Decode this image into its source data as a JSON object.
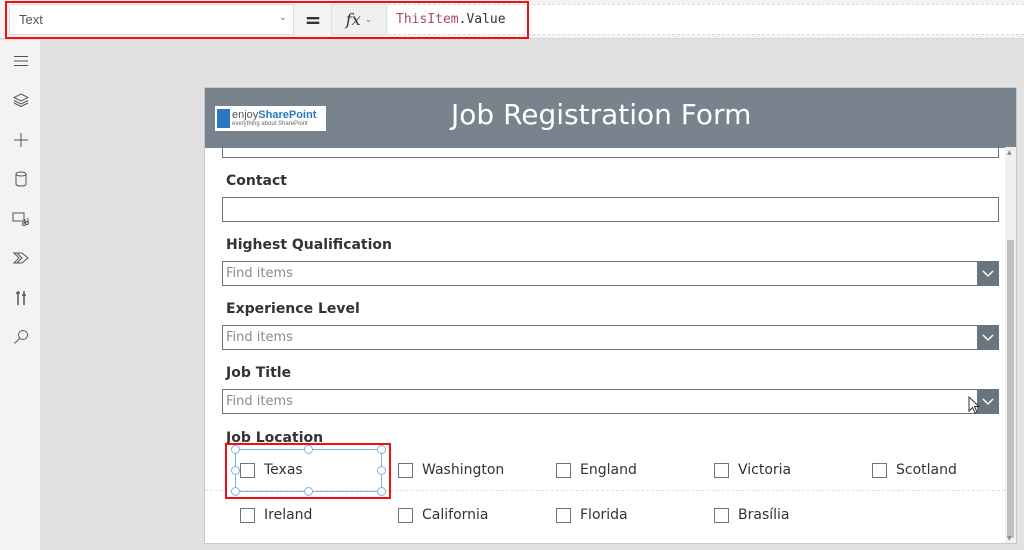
{
  "formula_bar": {
    "property": "Text",
    "equals": "=",
    "fx_label": "fx",
    "formula_keyword": "ThisItem",
    "formula_rest": ".Value"
  },
  "rail": {
    "icons": [
      "hamburger-menu-icon",
      "layers-icon",
      "insert-plus-icon",
      "data-cylinder-icon",
      "media-icon",
      "power-automate-icon",
      "advanced-tools-icon",
      "search-icon"
    ]
  },
  "app": {
    "logo": {
      "brand_prefix": "enjoy",
      "brand_main": "SharePoint",
      "tagline": "everything about SharePoint"
    },
    "title": "Job Registration Form",
    "fields": {
      "contact": {
        "label": "Contact",
        "value": ""
      },
      "qualification": {
        "label": "Highest Qualification",
        "placeholder": "Find items"
      },
      "experience": {
        "label": "Experience Level",
        "placeholder": "Find items"
      },
      "job_title": {
        "label": "Job Title",
        "placeholder": "Find items"
      },
      "location": {
        "label": "Job Location",
        "options": [
          {
            "label": "Texas",
            "checked": false
          },
          {
            "label": "Washington",
            "checked": false
          },
          {
            "label": "England",
            "checked": false
          },
          {
            "label": "Victoria",
            "checked": false
          },
          {
            "label": "Scotland",
            "checked": false
          },
          {
            "label": "Ireland",
            "checked": false
          },
          {
            "label": "California",
            "checked": false
          },
          {
            "label": "Florida",
            "checked": false
          },
          {
            "label": "Brasília",
            "checked": false
          }
        ]
      }
    }
  },
  "colors": {
    "header": "#78838e",
    "accent_dropdown": "#6b7580",
    "highlight": "#ee1111",
    "selection": "#7db3e0"
  }
}
